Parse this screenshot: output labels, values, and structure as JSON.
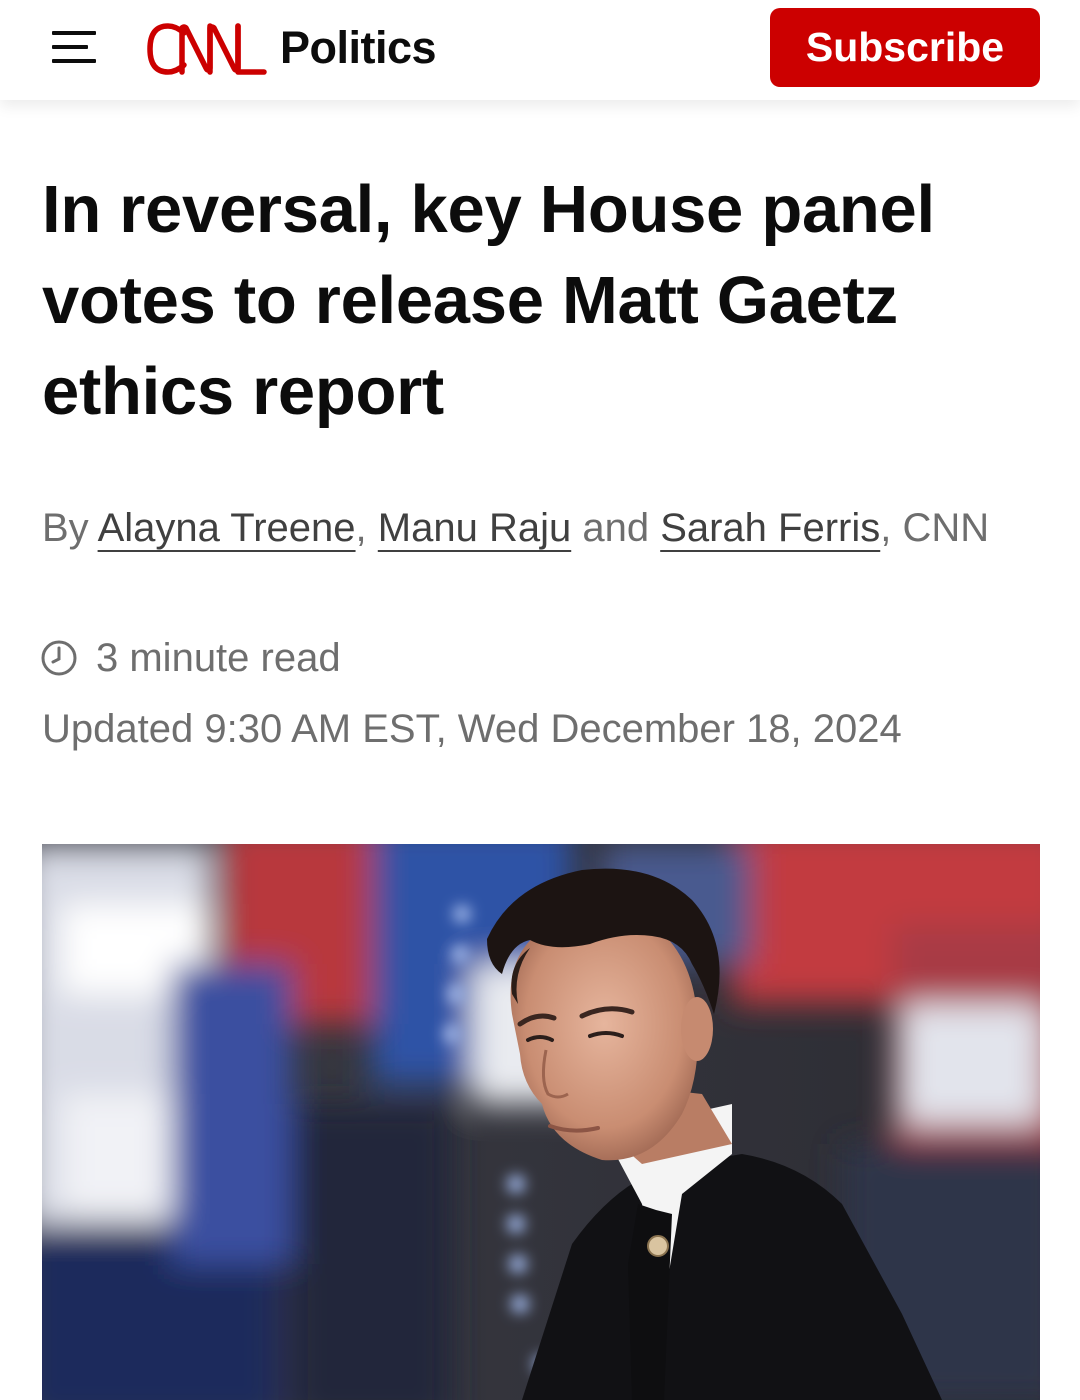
{
  "header": {
    "menu_icon": "hamburger-menu-icon",
    "logo_text": "CNN",
    "section_title": "Politics",
    "subscribe_label": "Subscribe",
    "brand_color": "#cc0000"
  },
  "article": {
    "headline": "In reversal, key House panel votes to release Matt Gaetz ethics report",
    "byline": {
      "prefix": "By ",
      "authors": [
        "Alayna Treene",
        "Manu Raju",
        "Sarah Ferris"
      ],
      "sep1": ", ",
      "sep2": " and ",
      "suffix": ", CNN"
    },
    "read_time_icon": "clock-icon",
    "read_time": "3 minute read",
    "updated": "Updated 9:30 AM EST, Wed December 18, 2024"
  }
}
